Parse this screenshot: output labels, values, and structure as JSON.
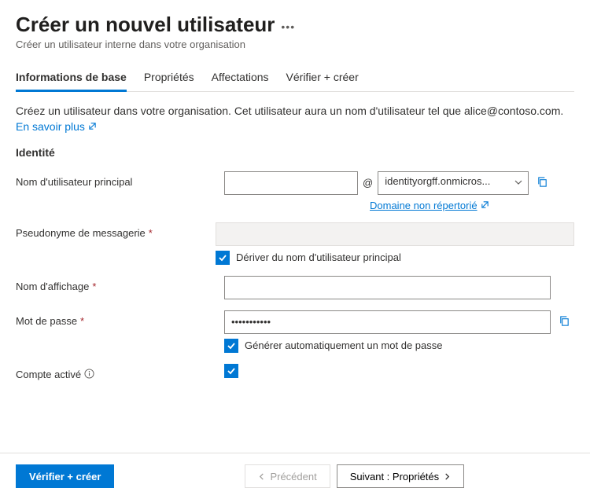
{
  "header": {
    "title": "Créer un nouvel utilisateur",
    "subtitle": "Créer un utilisateur interne dans votre organisation"
  },
  "tabs": {
    "basics": "Informations de base",
    "properties": "Propriétés",
    "assignments": "Affectations",
    "review": "Vérifier + créer"
  },
  "desc": {
    "text": "Créez un utilisateur dans votre organisation. Cet utilisateur aura un nom d'utilisateur tel que alice@contoso.com. ",
    "link": "En savoir plus"
  },
  "section_identity": "Identité",
  "fields": {
    "upn_label": "Nom d'utilisateur principal",
    "upn_at": "@",
    "domain_selected": "identityorgff.onmicros...",
    "domain_not_listed": "Domaine non répertorié",
    "mailnick_label": "Pseudonyme de messagerie",
    "mailnick_derive": "Dériver du nom d'utilisateur principal",
    "displayname_label": "Nom d'affichage",
    "password_label": "Mot de passe",
    "password_value": "•••••••••••",
    "password_autogen": "Générer automatiquement un mot de passe",
    "account_enabled_label": "Compte activé"
  },
  "footer": {
    "review_create": "Vérifier + créer",
    "previous": "Précédent",
    "next": "Suivant : Propriétés"
  }
}
